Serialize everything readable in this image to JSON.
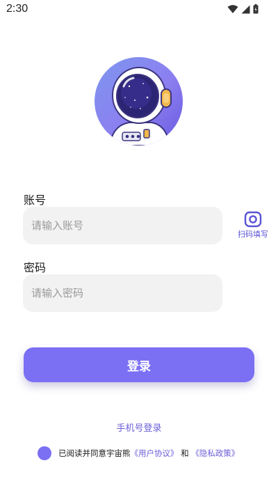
{
  "status_bar": {
    "time": "2:30",
    "icons": [
      "wifi-icon",
      "signal-icon",
      "battery-icon"
    ]
  },
  "avatar": {
    "icon": "astronaut-avatar"
  },
  "account": {
    "label": "账号",
    "placeholder": "请输入账号",
    "value": ""
  },
  "scan_fill": {
    "label": "扫码填写",
    "icon": "scan-icon"
  },
  "password": {
    "label": "密码",
    "placeholder": "请输入密码",
    "value": ""
  },
  "login_button": {
    "label": "登录"
  },
  "phone_login": {
    "label": "手机号登录"
  },
  "agreement": {
    "checked": true,
    "prefix": "已阅读并同意宇宙熊",
    "user_agreement": "《用户协议》",
    "and": "和",
    "privacy_policy": "《隐私政策》"
  },
  "colors": {
    "accent": "#7b6ff4",
    "link": "#6b5fd8",
    "input_bg": "#f2f2f2",
    "placeholder": "#9a9a9a"
  }
}
